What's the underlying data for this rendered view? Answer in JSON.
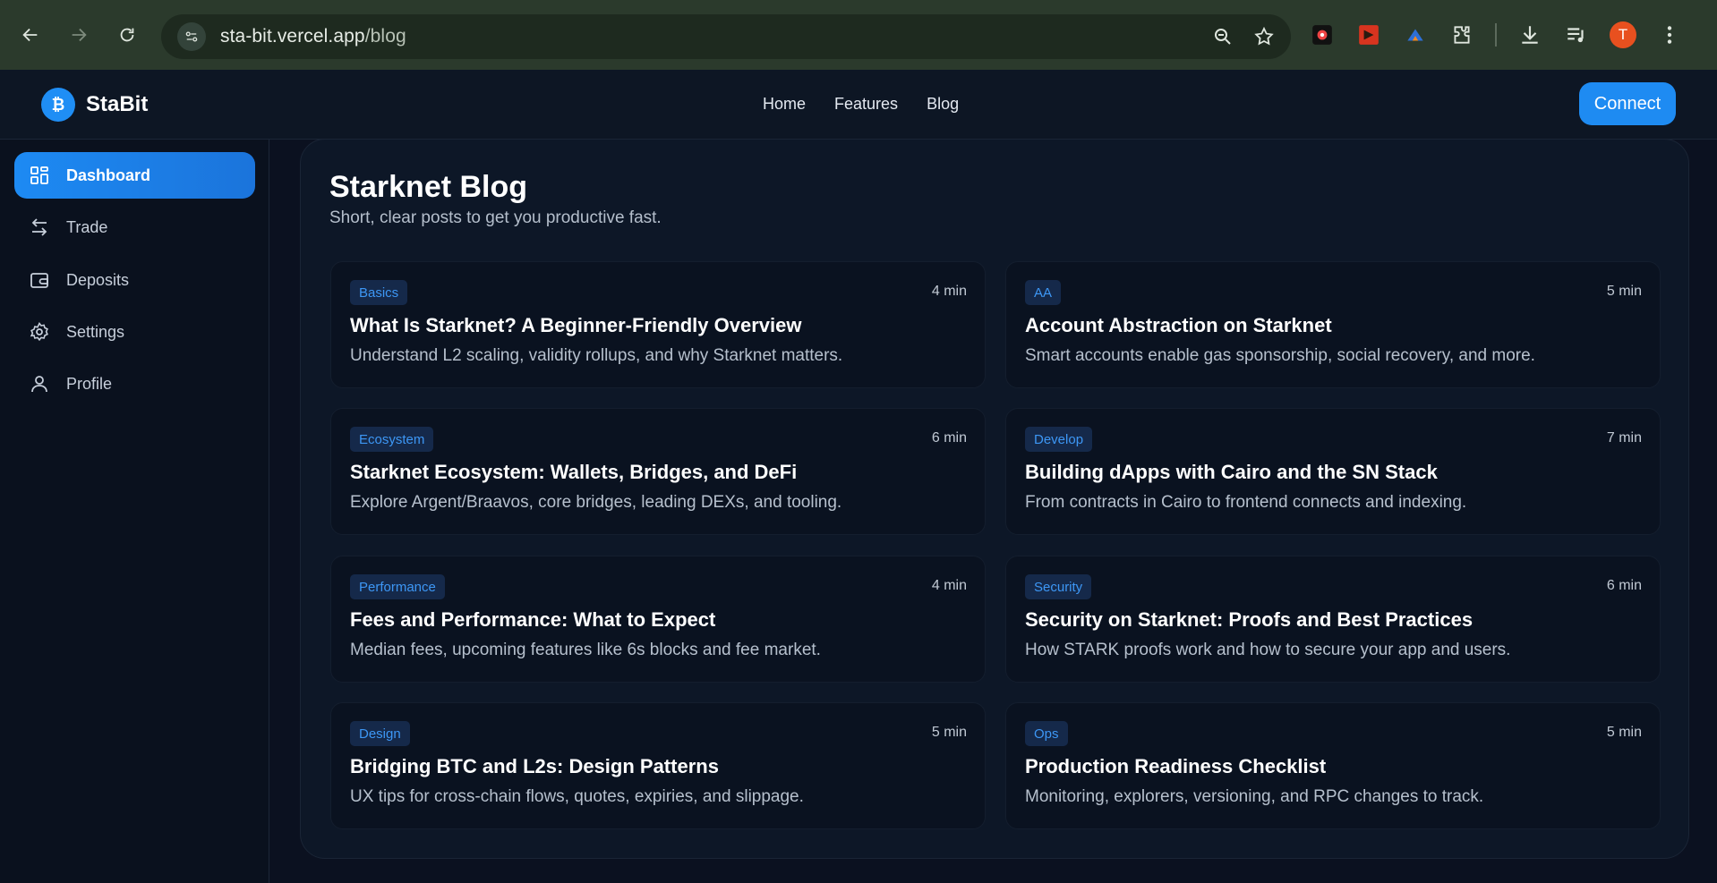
{
  "browser": {
    "url_host": "sta-bit.vercel.app",
    "url_path": "/blog",
    "avatar_letter": "T"
  },
  "header": {
    "brand": "StaBit",
    "brand_glyph": "₿",
    "nav": [
      "Home",
      "Features",
      "Blog"
    ],
    "connect_label": "Connect"
  },
  "sidebar": {
    "items": [
      {
        "label": "Dashboard",
        "icon": "grid-icon",
        "active": true
      },
      {
        "label": "Trade",
        "icon": "arrows-swap-icon",
        "active": false
      },
      {
        "label": "Deposits",
        "icon": "wallet-icon",
        "active": false
      },
      {
        "label": "Settings",
        "icon": "gear-icon",
        "active": false
      },
      {
        "label": "Profile",
        "icon": "user-icon",
        "active": false
      }
    ]
  },
  "blog": {
    "title": "Starknet Blog",
    "subtitle": "Short, clear posts to get you productive fast.",
    "posts": [
      {
        "tag": "Basics",
        "mins": "4 min",
        "title": "What Is Starknet? A Beginner-Friendly Overview",
        "desc": "Understand L2 scaling, validity rollups, and why Starknet matters."
      },
      {
        "tag": "AA",
        "mins": "5 min",
        "title": "Account Abstraction on Starknet",
        "desc": "Smart accounts enable gas sponsorship, social recovery, and more."
      },
      {
        "tag": "Ecosystem",
        "mins": "6 min",
        "title": "Starknet Ecosystem: Wallets, Bridges, and DeFi",
        "desc": "Explore Argent/Braavos, core bridges, leading DEXs, and tooling."
      },
      {
        "tag": "Develop",
        "mins": "7 min",
        "title": "Building dApps with Cairo and the SN Stack",
        "desc": "From contracts in Cairo to frontend connects and indexing."
      },
      {
        "tag": "Performance",
        "mins": "4 min",
        "title": "Fees and Performance: What to Expect",
        "desc": "Median fees, upcoming features like 6s blocks and fee market."
      },
      {
        "tag": "Security",
        "mins": "6 min",
        "title": "Security on Starknet: Proofs and Best Practices",
        "desc": "How STARK proofs work and how to secure your app and users."
      },
      {
        "tag": "Design",
        "mins": "5 min",
        "title": "Bridging BTC and L2s: Design Patterns",
        "desc": "UX tips for cross-chain flows, quotes, expiries, and slippage."
      },
      {
        "tag": "Ops",
        "mins": "5 min",
        "title": "Production Readiness Checklist",
        "desc": "Monitoring, explorers, versioning, and RPC changes to track."
      }
    ]
  },
  "colors": {
    "accent": "#1e8bf2",
    "background": "#0b1120",
    "tag_text": "#3d97f5"
  }
}
